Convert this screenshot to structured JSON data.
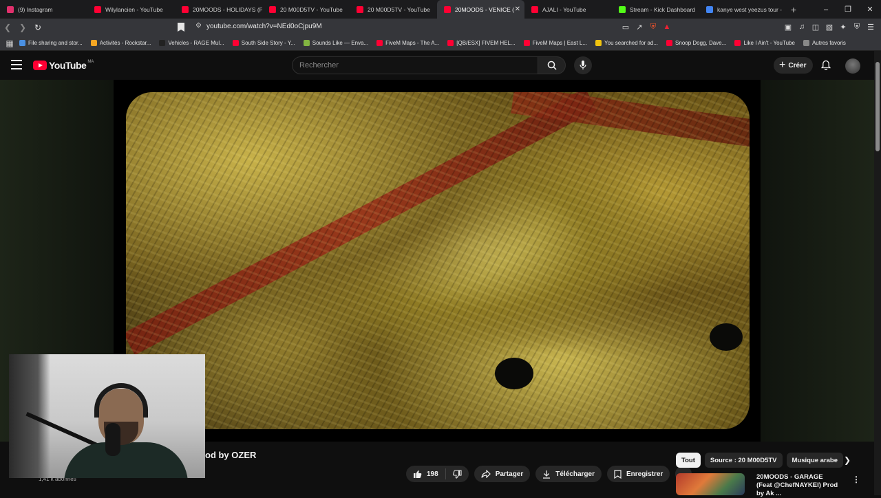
{
  "browser": {
    "tabs": [
      {
        "label": "(9) Instagram",
        "color": "#e1306c"
      },
      {
        "label": "Wilylancien - YouTube",
        "color": "#ff0033"
      },
      {
        "label": "20MOODS - HOLIDAYS (P",
        "color": "#ff0033"
      },
      {
        "label": "20 M00D5TV - YouTube",
        "color": "#ff0033"
      },
      {
        "label": "20 M00D5TV - YouTube",
        "color": "#ff0033"
      },
      {
        "label": "20MOODS - VENICE (",
        "color": "#ff0033",
        "active": true
      },
      {
        "label": "AJALI - YouTube",
        "color": "#ff0033"
      },
      {
        "label": "Stream - Kick Dashboard",
        "color": "#53fc18"
      },
      {
        "label": "kanye west yeezus tour - ",
        "color": "#4285f4"
      }
    ],
    "new_tab": "+",
    "url": "youtube.com/watch?v=NEd0oCjpu9M",
    "bookmarks": [
      {
        "label": "File sharing and stor...",
        "color": "#4a90e2"
      },
      {
        "label": "Activités - Rockstar...",
        "color": "#f5a623"
      },
      {
        "label": "Vehicles - RAGE Mul...",
        "color": "#222222"
      },
      {
        "label": "South Side Story - Y...",
        "color": "#ff0033"
      },
      {
        "label": "Sounds Like — Enva...",
        "color": "#82b541"
      },
      {
        "label": "FiveM Maps - The A...",
        "color": "#ff0033"
      },
      {
        "label": "[QB/ESX] FIVEM HEL...",
        "color": "#ff0033"
      },
      {
        "label": "FiveM Maps | East L...",
        "color": "#ff0033"
      },
      {
        "label": "You searched for ad...",
        "color": "#f1c40f"
      },
      {
        "label": "Snoop Dogg, Dave...",
        "color": "#ff0033"
      },
      {
        "label": "Like I Ain't - YouTube",
        "color": "#ff0033"
      },
      {
        "label": "Autres favoris",
        "color": "#888888"
      }
    ]
  },
  "youtube": {
    "logo_text": "YouTube",
    "region": "MA",
    "search_placeholder": "Rechercher",
    "create_label": "Créer",
    "video": {
      "title": "od by OZER",
      "subscribers": "1,41 k abonnés",
      "likes": "198",
      "share_label": "Partager",
      "download_label": "Télécharger",
      "save_label": "Enregistrer"
    },
    "chips": [
      {
        "label": "Tout",
        "selected": true
      },
      {
        "label": "Source : 20 M00D5TV"
      },
      {
        "label": "Musique arabe"
      }
    ],
    "recommendation": {
      "title": "20MOODS - GARAGE (Feat @ChefNAYKEI) Prod by Ak ..."
    }
  }
}
